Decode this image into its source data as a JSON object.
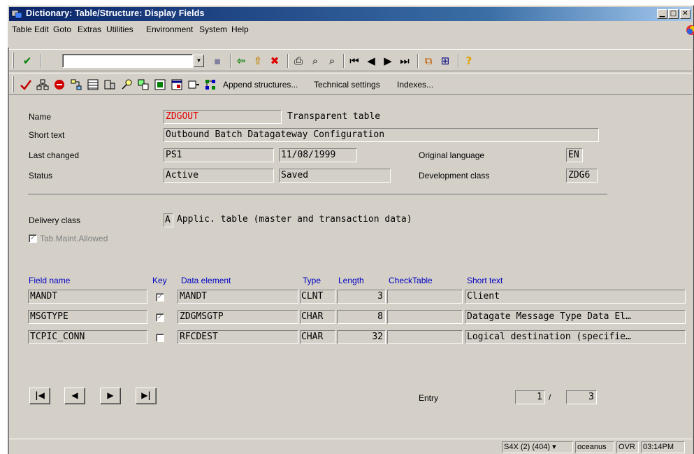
{
  "window": {
    "title": "Dictionary: Table/Structure: Display Fields"
  },
  "title_buttons": {
    "minimize": "▁",
    "maximize": "□",
    "close": "✕"
  },
  "menu": [
    {
      "label": "Table"
    },
    {
      "label": "Edit"
    },
    {
      "label": "Goto"
    },
    {
      "label": "Extras"
    },
    {
      "label": "Utilities"
    },
    {
      "label": "Environment"
    },
    {
      "label": "System"
    },
    {
      "label": "Help"
    }
  ],
  "standard_toolbar": {
    "command_field_value": "",
    "icons": {
      "enter": "✔",
      "save": "▪",
      "back": "⇦",
      "exit": "⇧",
      "cancel": "✖",
      "print": "⎙",
      "find": "⌕",
      "find_next": "⌕",
      "first_page": "⏮",
      "prev_page": "◀",
      "next_page": "▶",
      "last_page": "⏭",
      "create_session": "⧉",
      "shortcut": "⊞",
      "help": "?"
    }
  },
  "application_toolbar": {
    "icons": [
      "check-icon",
      "where-used-icon",
      "activate-icon",
      "hierarchy-icon",
      "table-contents-icon",
      "structure-icon",
      "search-help-icon",
      "foreign-key-icon",
      "output-icon",
      "input-icon",
      "next-icon",
      "graphic-icon"
    ],
    "links": [
      "Append structures...",
      "Technical settings",
      "Indexes..."
    ]
  },
  "form": {
    "name_label": "Name",
    "name_value": "ZDGOUT",
    "table_kind": "Transparent table",
    "short_text_label": "Short text",
    "short_text_value": "Outbound Batch Datagateway Configuration",
    "last_changed_label": "Last changed",
    "last_changed_user": "PS1",
    "last_changed_date": "11/08/1999",
    "orig_lang_label": "Original language",
    "orig_lang_value": "EN",
    "status_label": "Status",
    "status_value": "Active",
    "status_saved": "Saved",
    "dev_class_label": "Development class",
    "dev_class_value": "ZDG6",
    "delivery_class_label": "Delivery class",
    "delivery_class_code": "A",
    "delivery_class_text": "Applic. table (master and transaction data)",
    "tab_maint_label": "Tab.Maint.Allowed"
  },
  "table": {
    "headers": {
      "field": "Field name",
      "key": "Key",
      "element": "Data element",
      "type": "Type",
      "length": "Length",
      "check": "CheckTable",
      "short": "Short text"
    },
    "rows": [
      {
        "field": "MANDT",
        "key": true,
        "element": "MANDT",
        "type": "CLNT",
        "length": "3",
        "check": "",
        "short": "Client"
      },
      {
        "field": "MSGTYPE",
        "key": true,
        "element": "ZDGMSGTP",
        "type": "CHAR",
        "length": "8",
        "check": "",
        "short": "Datagate Message Type Data El…"
      },
      {
        "field": "TCPIC_CONN",
        "key": false,
        "element": "RFCDEST",
        "type": "CHAR",
        "length": "32",
        "check": "",
        "short": "Logical destination (specifie…"
      }
    ]
  },
  "entry": {
    "label": "Entry",
    "current": "1",
    "separator": "/",
    "total": "3"
  },
  "status_bar": {
    "system": "S4X (2) (404)",
    "dropdown": "▾",
    "host": "oceanus",
    "mode": "OVR",
    "time": "03:14PM"
  },
  "colors": {
    "title_bar": "#0a246a",
    "window_bg": "#d4d0c8",
    "name_value": "#e00000",
    "header_text": "#0000c0"
  }
}
